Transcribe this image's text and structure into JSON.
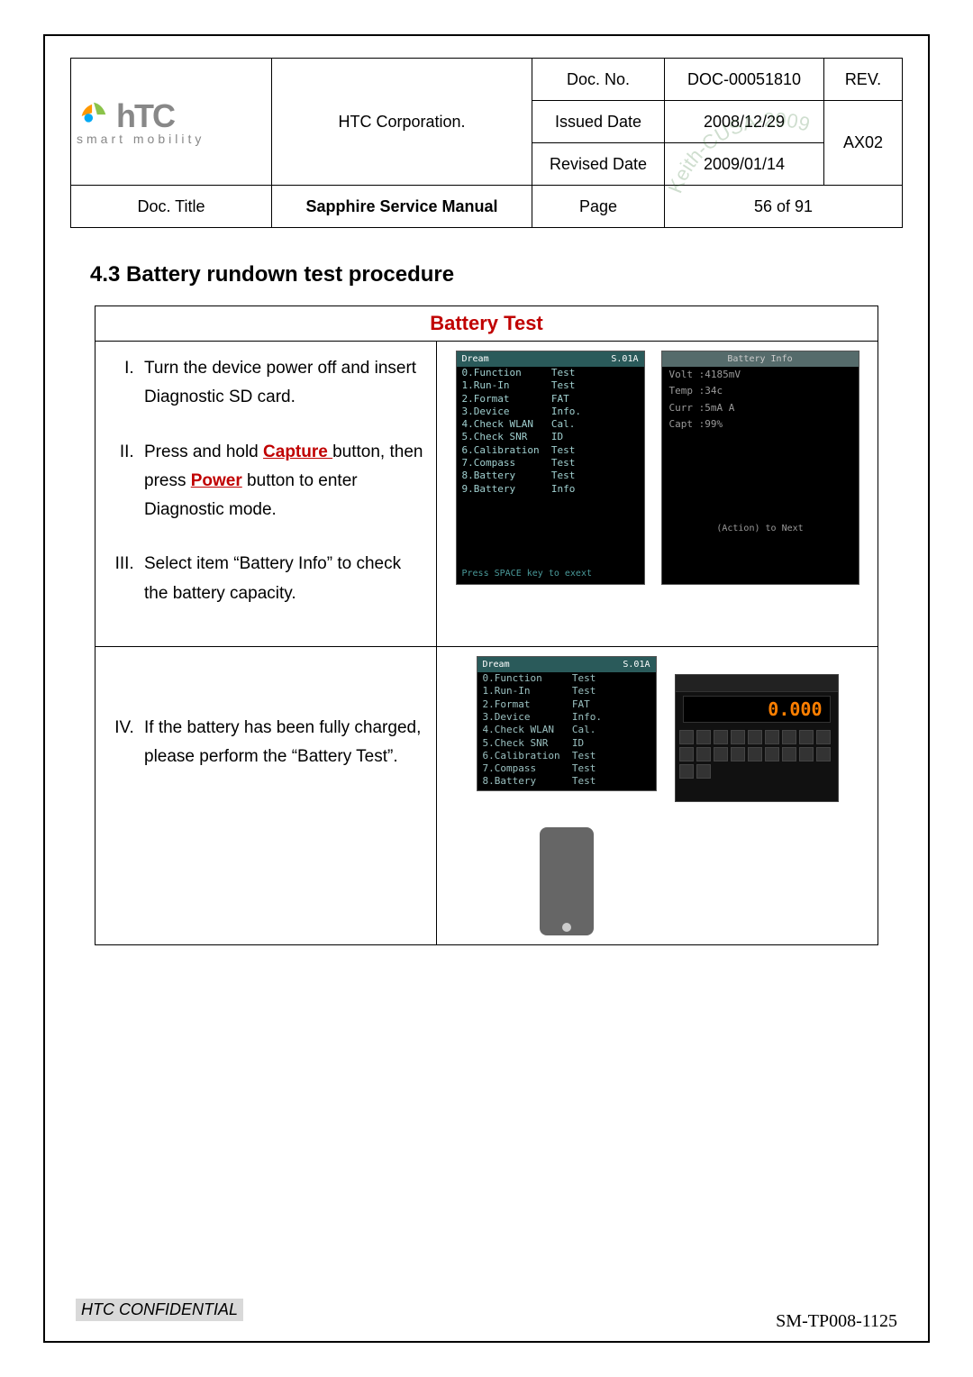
{
  "header": {
    "company_name": "HTC Corporation.",
    "logo_text": "hTC",
    "logo_sub": "smart mobility",
    "doc_no_label": "Doc. No.",
    "doc_no": "DOC-00051810",
    "rev_label": "REV.",
    "rev": "AX02",
    "issued_label": "Issued Date",
    "issued": "2008/12/29",
    "revised_label": "Revised Date",
    "revised": "2009/01/14",
    "doc_title_label": "Doc. Title",
    "doc_title": "Sapphire Service Manual",
    "page_label": "Page",
    "page": "56 of 91"
  },
  "section_heading": "4.3 Battery rundown test procedure",
  "battery_table_header": "Battery Test",
  "steps_a": {
    "s1": "Turn the device power off and insert Diagnostic SD card.",
    "s2_pre": "Press and hold ",
    "s2_capture": "Capture ",
    "s2_mid": "button, then press ",
    "s2_power": "Power",
    "s2_post": " button to enter Diagnostic mode.",
    "s3": "Select item “Battery Info” to check the battery capacity."
  },
  "steps_b": {
    "s4": "If the battery has been fully charged, please perform the “Battery Test”."
  },
  "screen_menu": {
    "title_left": "Dream",
    "title_right": "S.01A",
    "items": [
      "0.Function     Test",
      "1.Run-In       Test",
      "2.Format       FAT",
      "3.Device       Info.",
      "4.Check WLAN   Cal.",
      "5.Check SNR    ID",
      "6.Calibration  Test",
      "7.Compass      Test",
      "8.Battery      Test",
      "9.Battery      Info"
    ],
    "footer": "Press SPACE key to exext"
  },
  "screen_info": {
    "title": "Battery Info",
    "rows": [
      "Volt :4185mV",
      "Temp :34c",
      "Curr :5mA A",
      "Capt :99%"
    ],
    "action": "(Action) to Next"
  },
  "screen_menu2": {
    "title_left": "Dream",
    "title_right": "S.01A",
    "items": [
      "0.Function     Test",
      "1.Run-In       Test",
      "2.Format       FAT",
      "3.Device       Info.",
      "4.Check WLAN   Cal.",
      "5.Check SNR    ID",
      "6.Calibration  Test",
      "7.Compass      Test",
      "8.Battery      Test"
    ]
  },
  "clock_value": "0.000",
  "footer_conf": "HTC CONFIDENTIAL",
  "footer_code": "SM-TP008-1125",
  "watermark": "Keith-CUSA-2009"
}
